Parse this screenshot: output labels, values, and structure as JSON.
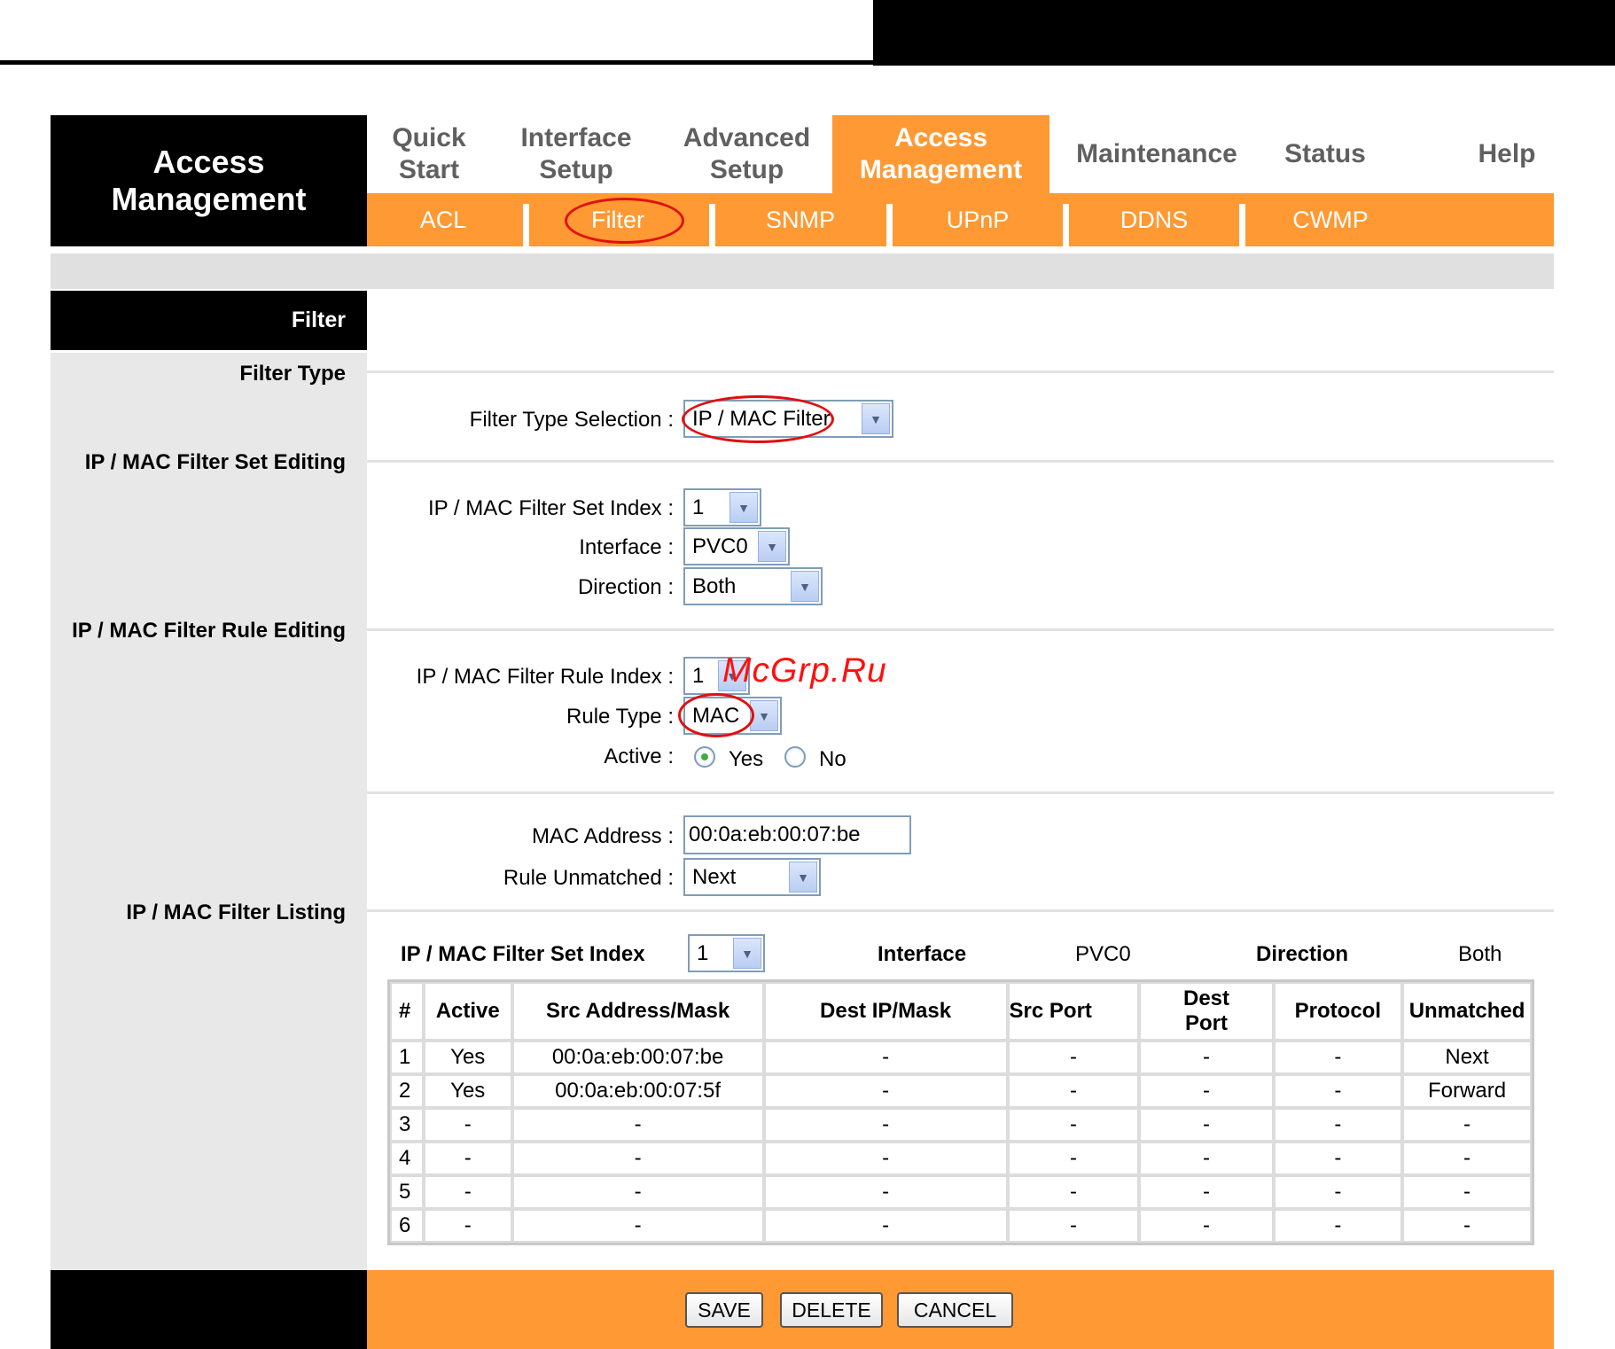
{
  "brand": {
    "title": "Access Management"
  },
  "nav": {
    "tabs": [
      {
        "label": "Quick Start"
      },
      {
        "label": "Interface Setup"
      },
      {
        "label": "Advanced Setup"
      },
      {
        "label": "Access Management"
      },
      {
        "label": "Maintenance"
      },
      {
        "label": "Status"
      },
      {
        "label": "Help"
      }
    ],
    "active_tab": "Access Management",
    "subtabs": [
      {
        "label": "ACL"
      },
      {
        "label": "Filter"
      },
      {
        "label": "SNMP"
      },
      {
        "label": "UPnP"
      },
      {
        "label": "DDNS"
      },
      {
        "label": "CWMP"
      }
    ],
    "active_subtab": "Filter"
  },
  "page": {
    "title": "Filter"
  },
  "sections": {
    "filter_type": "Filter Type",
    "set_editing": "IP / MAC Filter Set Editing",
    "rule_editing": "IP / MAC Filter Rule Editing",
    "listing": "IP / MAC Filter Listing"
  },
  "form": {
    "filter_type_selection": {
      "label": "Filter Type Selection :",
      "value": "IP / MAC Filter"
    },
    "set_index": {
      "label": "IP / MAC Filter Set Index :",
      "value": "1"
    },
    "interface": {
      "label": "Interface :",
      "value": "PVC0"
    },
    "direction": {
      "label": "Direction :",
      "value": "Both"
    },
    "rule_index": {
      "label": "IP / MAC Filter Rule Index :",
      "value": "1"
    },
    "rule_type": {
      "label": "Rule Type :",
      "value": "MAC"
    },
    "active": {
      "label": "Active :",
      "yes": "Yes",
      "no": "No",
      "selected": "Yes"
    },
    "mac_address": {
      "label": "MAC Address :",
      "value": "00:0a:eb:00:07:be"
    },
    "rule_unmatched": {
      "label": "Rule Unmatched :",
      "value": "Next"
    }
  },
  "listing": {
    "set_index_label": "IP / MAC Filter Set Index",
    "set_index_value": "1",
    "interface_label": "Interface",
    "interface_value": "PVC0",
    "direction_label": "Direction",
    "direction_value": "Both",
    "columns": [
      "#",
      "Active",
      "Src Address/Mask",
      "Dest IP/Mask",
      "Src Port",
      "Dest Port",
      "Protocol",
      "Unmatched"
    ],
    "rows": [
      [
        "1",
        "Yes",
        "00:0a:eb:00:07:be",
        "-",
        "-",
        "-",
        "-",
        "Next"
      ],
      [
        "2",
        "Yes",
        "00:0a:eb:00:07:5f",
        "-",
        "-",
        "-",
        "-",
        "Forward"
      ],
      [
        "3",
        "-",
        "-",
        "-",
        "-",
        "-",
        "-",
        "-"
      ],
      [
        "4",
        "-",
        "-",
        "-",
        "-",
        "-",
        "-",
        "-"
      ],
      [
        "5",
        "-",
        "-",
        "-",
        "-",
        "-",
        "-",
        "-"
      ],
      [
        "6",
        "-",
        "-",
        "-",
        "-",
        "-",
        "-",
        "-"
      ]
    ]
  },
  "buttons": {
    "save": "SAVE",
    "delete": "DELETE",
    "cancel": "CANCEL"
  },
  "watermark": "McGrp.Ru",
  "colors": {
    "accent": "#ff9933",
    "annotation": "#e01010",
    "panel": "#e8e8e8"
  }
}
